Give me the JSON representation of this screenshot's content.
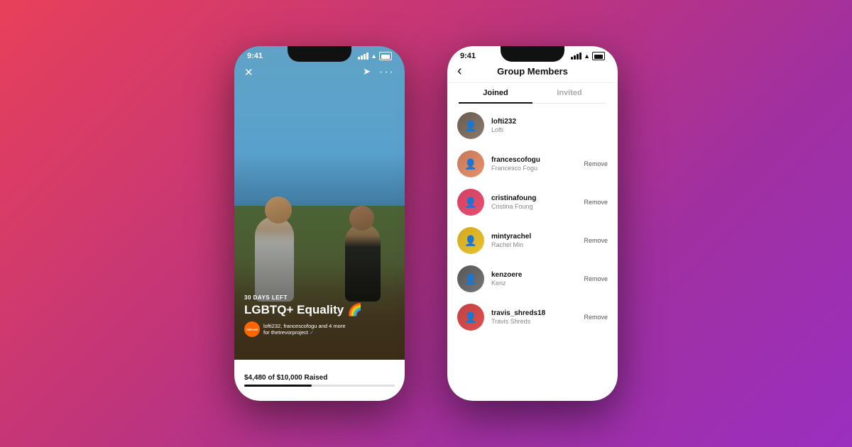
{
  "background": {
    "gradient_start": "#e8405a",
    "gradient_end": "#9b2fbf"
  },
  "phone1": {
    "status_time": "9:41",
    "story": {
      "days_left": "30 DAYS LEFT",
      "title": "LGBTQ+ Equality",
      "emoji": "🌈",
      "meta": "lofti232, francescofogu and 4 more",
      "org": "for thetrevorproject",
      "trevor_label": "TREVOR",
      "raised_text": "$4,480 of $10,000 Raised",
      "progress_pct": 45
    }
  },
  "phone2": {
    "status_time": "9:41",
    "header": {
      "back_icon": "‹",
      "title": "Group Members"
    },
    "tabs": [
      {
        "label": "Joined",
        "active": true
      },
      {
        "label": "Invited",
        "active": false
      }
    ],
    "members": [
      {
        "username": "lofti232",
        "display_name": "Lofti",
        "has_remove": false,
        "av_class": "av1"
      },
      {
        "username": "francescofogu",
        "display_name": "Francesco Fogu",
        "has_remove": true,
        "av_class": "av2"
      },
      {
        "username": "cristinafoung",
        "display_name": "Cristina Foung",
        "has_remove": true,
        "av_class": "av3"
      },
      {
        "username": "mintyrachel",
        "display_name": "Rachel Min",
        "has_remove": true,
        "av_class": "av4"
      },
      {
        "username": "kenzoere",
        "display_name": "Kenz",
        "has_remove": true,
        "av_class": "av5"
      },
      {
        "username": "travis_shreds18",
        "display_name": "Travis Shreds",
        "has_remove": true,
        "av_class": "av6"
      }
    ],
    "remove_label": "Remove"
  }
}
